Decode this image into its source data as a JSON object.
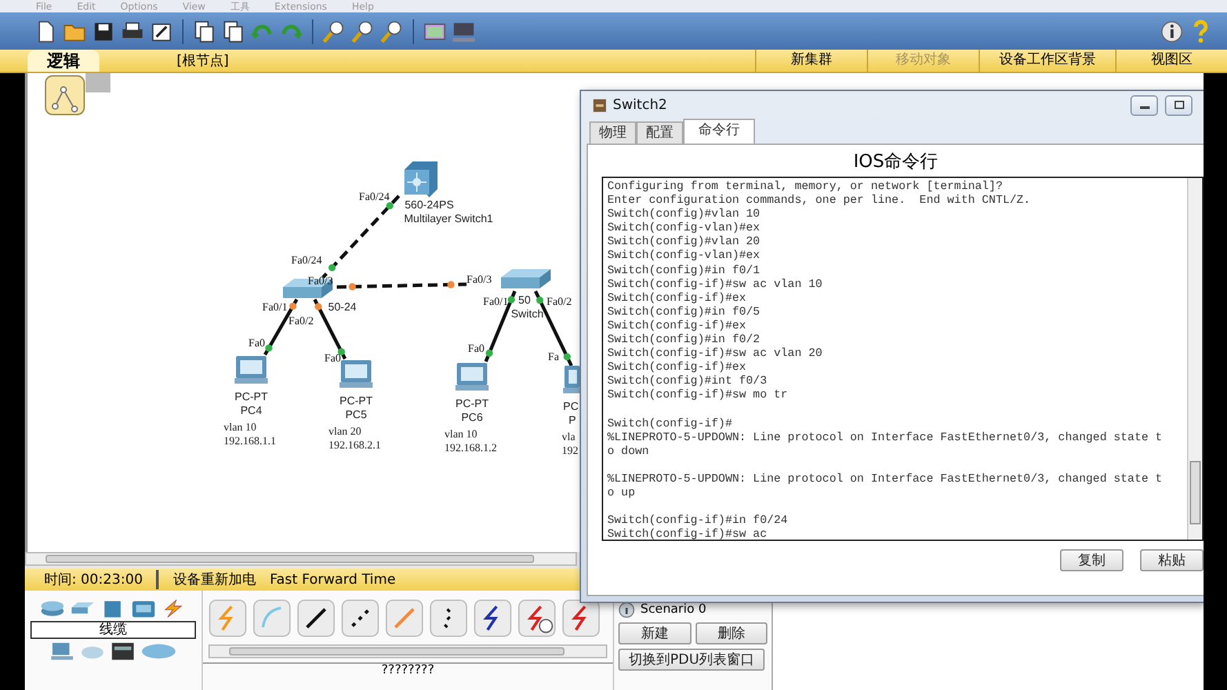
{
  "menu": [
    "File",
    "Edit",
    "Options",
    "View",
    "工具",
    "Extensions",
    "Help"
  ],
  "workspace_bar": {
    "tab": "逻辑",
    "path": "[根节点]",
    "actions": [
      {
        "label": "新集群",
        "disabled": false
      },
      {
        "label": "移动对象",
        "disabled": true
      },
      {
        "label": "设备工作区背景",
        "disabled": false
      },
      {
        "label": "视图区",
        "disabled": false
      }
    ]
  },
  "topology": {
    "devices": [
      {
        "kind": "multilayer_switch",
        "labels": [
          "560-24PS",
          "Multilayer Switch1"
        ]
      },
      {
        "kind": "switch",
        "labels": [
          "50-24"
        ]
      },
      {
        "kind": "switch",
        "labels": [
          "50",
          "Switch"
        ]
      },
      {
        "kind": "pc",
        "labels": [
          "PC-PT",
          "PC4",
          "vlan 10",
          "192.168.1.1"
        ]
      },
      {
        "kind": "pc",
        "labels": [
          "PC-PT",
          "PC5",
          "vlan 20",
          "192.168.2.1"
        ]
      },
      {
        "kind": "pc",
        "labels": [
          "PC-PT",
          "PC6",
          "vlan 10",
          "192.168.1.2"
        ]
      },
      {
        "kind": "pc",
        "labels": [
          "PC",
          "P",
          "vla",
          "192"
        ]
      }
    ],
    "links": [
      {
        "ports": [
          {
            "label": "Fa0/24",
            "color": "#33b24a"
          },
          {
            "label": "Fa0/24",
            "color": "#33b24a"
          }
        ]
      },
      {
        "ports": [
          {
            "label": "Fa0/3",
            "color": "#f08a3c"
          },
          {
            "label": "Fa0/3",
            "color": "#f08a3c"
          }
        ]
      },
      {
        "ports": [
          {
            "label": "Fa0/1",
            "color": "#f08a3c"
          },
          {
            "label": "Fa0",
            "color": "#33b24a"
          }
        ]
      },
      {
        "ports": [
          {
            "label": "Fa0/2",
            "color": "#f08a3c"
          },
          {
            "label": "Fa0",
            "color": "#33b24a"
          }
        ]
      },
      {
        "ports": [
          {
            "label": "Fa0/1",
            "color": "#33b24a"
          },
          {
            "label": "Fa0",
            "color": "#33b24a"
          }
        ]
      },
      {
        "ports": [
          {
            "label": "Fa0/2",
            "color": "#33b24a"
          },
          {
            "label": "Fa",
            "color": "#33b24a"
          }
        ]
      }
    ]
  },
  "status_bar": {
    "time": "时间: 00:23:00",
    "actions": [
      "设备重新加电",
      "Fast Forward Time"
    ]
  },
  "device_panel": {
    "category": "线缆",
    "selection": "????????"
  },
  "scenario": {
    "name": "Scenario 0",
    "buttons": [
      "新建",
      "删除"
    ],
    "toggle": "切换到PDU列表窗口"
  },
  "window": {
    "title": "Switch2",
    "tabs": [
      {
        "label": "物理",
        "selected": false
      },
      {
        "label": "配置",
        "selected": false
      },
      {
        "label": "命令行",
        "selected": true
      }
    ],
    "heading": "IOS命令行",
    "terminal": "Configuring from terminal, memory, or network [terminal]?\nEnter configuration commands, one per line.  End with CNTL/Z.\nSwitch(config)#vlan 10\nSwitch(config-vlan)#ex\nSwitch(config)#vlan 20\nSwitch(config-vlan)#ex\nSwitch(config)#in f0/1\nSwitch(config-if)#sw ac vlan 10\nSwitch(config-if)#ex\nSwitch(config)#in f0/5\nSwitch(config-if)#ex\nSwitch(config)#in f0/2\nSwitch(config-if)#sw ac vlan 20\nSwitch(config-if)#ex\nSwitch(config)#int f0/3\nSwitch(config-if)#sw mo tr\n\nSwitch(config-if)#\n%LINEPROTO-5-UPDOWN: Line protocol on Interface FastEthernet0/3, changed state t\no down\n\n%LINEPROTO-5-UPDOWN: Line protocol on Interface FastEthernet0/3, changed state t\no up\n\nSwitch(config-if)#in f0/24\nSwitch(config-if)#sw ac",
    "buttons": [
      "复制",
      "粘贴"
    ]
  }
}
